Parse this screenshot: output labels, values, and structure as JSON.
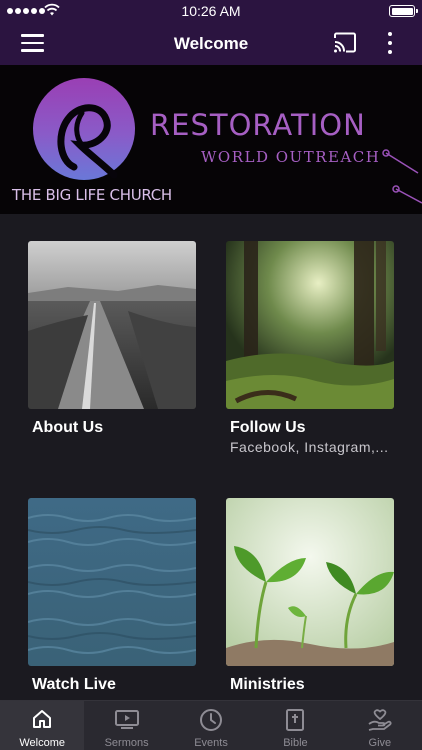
{
  "status_bar": {
    "time": "10:26 AM",
    "signal_icon": "signal-dots-icon",
    "wifi_icon": "wifi-icon",
    "battery_level": 1.0
  },
  "app_bar": {
    "title": "Welcome",
    "menu_icon": "hamburger-menu-icon",
    "cast_icon": "cast-icon",
    "more_icon": "more-vertical-icon"
  },
  "banner": {
    "title": "RESTORATION",
    "subtitle": "WORLD OUTREACH",
    "church_name": "THE BIG LIFE CHURCH",
    "logo_icon": "restoration-logo-icon",
    "brand_color": "#a65fc3"
  },
  "tiles": [
    {
      "title": "About Us",
      "subtitle": "",
      "image": "country-road-photo"
    },
    {
      "title": "Follow Us",
      "subtitle": "Facebook, Instagram,...",
      "image": "forest-photo"
    },
    {
      "title": "Watch Live",
      "subtitle": "",
      "image": "ocean-water-photo"
    },
    {
      "title": "Ministries",
      "subtitle": "",
      "image": "seedling-photo"
    }
  ],
  "tab_bar": {
    "active": "Welcome",
    "tabs": [
      {
        "label": "Welcome",
        "icon": "home-icon"
      },
      {
        "label": "Sermons",
        "icon": "video-play-icon"
      },
      {
        "label": "Events",
        "icon": "clock-icon"
      },
      {
        "label": "Bible",
        "icon": "bible-icon"
      },
      {
        "label": "Give",
        "icon": "give-heart-hand-icon"
      }
    ]
  },
  "colors": {
    "header_bg": "#2b1440",
    "content_bg": "#1b1a20",
    "tabbar_bg": "#2a2930"
  }
}
